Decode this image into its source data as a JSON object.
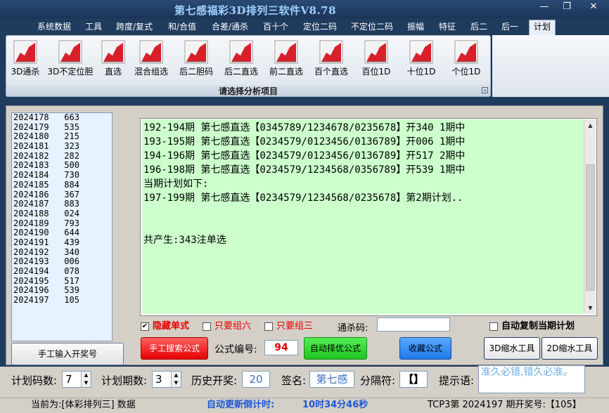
{
  "window": {
    "title": "第七感福彩3D排列三软件V8.78",
    "minimize": "—",
    "restore": "❐",
    "close": "✕"
  },
  "menu": [
    "系统数据",
    "工具",
    "跨度/复式",
    "和/合值",
    "合差/通杀",
    "百十个",
    "定位二码",
    "不定位二码",
    "振幅",
    "特征",
    "后二",
    "后一",
    "计划"
  ],
  "ribbon": {
    "buttons": [
      "3D通杀",
      "3D不定位胆",
      "直选",
      "混合组选",
      "后二胆码",
      "后二直选",
      "前二直选",
      "百个直选",
      "百位1D",
      "十位1D",
      "个位1D"
    ],
    "group_label": "请选择分析项目"
  },
  "history": [
    [
      "2024178",
      "663"
    ],
    [
      "2024179",
      "535"
    ],
    [
      "2024180",
      "215"
    ],
    [
      "2024181",
      "323"
    ],
    [
      "2024182",
      "282"
    ],
    [
      "2024183",
      "500"
    ],
    [
      "2024184",
      "730"
    ],
    [
      "2024185",
      "884"
    ],
    [
      "2024186",
      "367"
    ],
    [
      "2024187",
      "883"
    ],
    [
      "2024188",
      "024"
    ],
    [
      "2024189",
      "793"
    ],
    [
      "2024190",
      "644"
    ],
    [
      "2024191",
      "439"
    ],
    [
      "2024192",
      "340"
    ],
    [
      "2024193",
      "006"
    ],
    [
      "2024194",
      "078"
    ],
    [
      "2024195",
      "517"
    ],
    [
      "2024196",
      "539"
    ],
    [
      "2024197",
      "105"
    ]
  ],
  "manual_button": "手工输入开奖号",
  "output_lines": [
    "192-194期 第七感直选【0345789/1234678/0235678】开340 1期中",
    "193-195期 第七感直选【0234579/0123456/0136789】开006 1期中",
    "194-196期 第七感直选【0234579/0123456/0136789】开517 2期中",
    "196-198期 第七感直选【0234579/1234568/0356789】开539 1期中",
    "当期计划如下:",
    "197-199期 第七感直选【0234579/1234568/0235678】第2期计划..",
    "",
    "",
    "共产生:343注单选"
  ],
  "options": {
    "hide_single": {
      "label": "隐藏单式",
      "checked": true
    },
    "only_group6": {
      "label": "只要组六",
      "checked": false
    },
    "only_group3": {
      "label": "只要组三",
      "checked": false
    },
    "kill_code_label": "通杀码:",
    "kill_code_value": "",
    "auto_copy": {
      "label": "自动复制当期计划",
      "checked": false
    }
  },
  "actions": {
    "manual_search": "手工搜索公式",
    "formula_no_label": "公式编号:",
    "formula_no": "94",
    "auto_select": "自动择优公式",
    "favorite": "收藏公式",
    "shrink_3d": "3D缩水工具",
    "shrink_2d": "2D缩水工具"
  },
  "params": {
    "plan_codes_label": "计划码数:",
    "plan_codes": "7",
    "plan_periods_label": "计划期数:",
    "plan_periods": "3",
    "history_label": "历史开奖:",
    "history_value": "20",
    "signature_label": "签名:",
    "signature_value": "第七感",
    "separator_label": "分隔符:",
    "separator_value": "【】",
    "hint_label": "提示语:",
    "hint_value": "准久必错,错久必准。"
  },
  "status": {
    "current": "当前为:[体彩排列三] 数据",
    "countdown_label": "自动更新倒计时:",
    "countdown": "10时34分46秒",
    "issue": "TCP3第 2024197 期开奖号:【105】"
  },
  "colors": {
    "output_bg": "#ccffcc",
    "history_bg": "#e6f2ff",
    "accent": "#1f3b5e",
    "red": "#e60000"
  }
}
